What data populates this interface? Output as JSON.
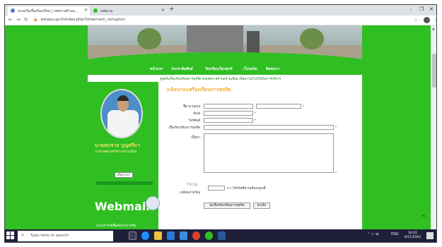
{
  "browser": {
    "tabs": [
      {
        "label": "ระบบรับเรื่องร้องเรียน | เทศบาลตำบล..."
      },
      {
        "label": "เทศบาล"
      }
    ],
    "url": "banpeu.go.th/index.php/?show=anti_corruption",
    "icons": {
      "back": "back-arrow-icon",
      "forward": "forward-arrow-icon",
      "reload": "reload-icon",
      "lock": "lock-icon",
      "star": "star-icon"
    }
  },
  "site": {
    "menu": [
      "หน้าแรก",
      "ประชาสัมพันธ์",
      "ร้องเรียน/ร้องทุกข์",
      "เว็บบอร์ด",
      "ติดต่อเรา"
    ],
    "notice": "ศูนย์รับเรื่องร้องเรียนการทุจริต คนเทศบาลตำบลบ้านเปือย เพื่อความโปร่งใสในการบริหาร"
  },
  "sidebar": {
    "person_name": "นายสมชาย บุญศรีมา",
    "person_title": "นายกเทศมนตรีตำบลบ้านเปือย",
    "badge_button": "เลือกภาษา",
    "webmail": "Webmail",
    "footer": "ระบบการจัดซื้อจัดจ้างภาครัฐ"
  },
  "form": {
    "title": "แจ้งเบาะแสร้องเรียนการทุจริต",
    "name_label": "ชื่อ-นามสกุล :",
    "email_label": "อีเมล์ :",
    "phone_label": "โทรศัพท์ :",
    "subject_label": "เรื่องร้องเรียนการทุจริต :",
    "detail_label": "เนื้อหา :",
    "captcha_text": "7k3p",
    "captcha_label": "เปลี่ยนภาพใหม่",
    "captcha_hint": "<<-ใส่รหัสที่ท่านเห็นบนรูปนี้",
    "submit_label": "ส่งเรื่องร้องเรียนการทุจริต",
    "cancel_label": "ยกเลิก"
  },
  "taskbar": {
    "search_placeholder": "Type here to search",
    "lang": "ENG",
    "time": "14:01",
    "date": "8/11/2563"
  },
  "colors": {
    "page_green": "#2fbf22",
    "accent_orange": "#f5a623"
  }
}
